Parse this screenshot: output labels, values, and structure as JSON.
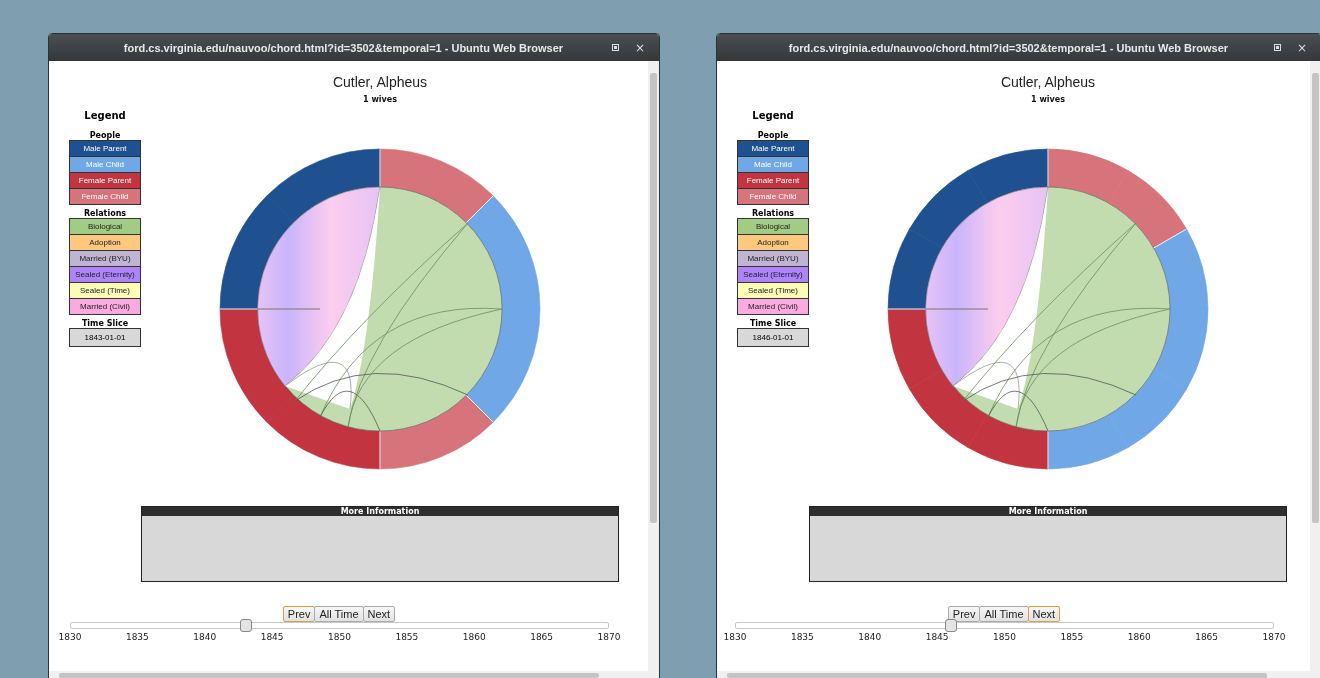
{
  "windows": [
    {
      "title": "ford.cs.virginia.edu/nauvoo/chord.html?id=3502&temporal=1 - Ubuntu Web Browser",
      "close": "×",
      "heading": "Cutler, Alpheus",
      "subheading": "1 wives",
      "legend": {
        "title": "Legend",
        "people_title": "People",
        "people": [
          {
            "label": "Male Parent",
            "color": "#1f5190"
          },
          {
            "label": "Male Child",
            "color": "#70a7e6"
          },
          {
            "label": "Female Parent",
            "color": "#c13440"
          },
          {
            "label": "Female Child",
            "color": "#d6737b"
          }
        ],
        "relations_title": "Relations",
        "relations": [
          {
            "label": "Biological",
            "color": "#a2cc85"
          },
          {
            "label": "Adoption",
            "color": "#fec97f"
          },
          {
            "label": "Married (BYU)",
            "color": "#bfb5d3"
          },
          {
            "label": "Sealed (Eternity)",
            "color": "#ad84fc"
          },
          {
            "label": "Sealed (Time)",
            "color": "#fbfdb6"
          },
          {
            "label": "Married (Civil)",
            "color": "#fbaae0"
          }
        ],
        "time_slice_title": "Time Slice",
        "time_slice": "1843-01-01"
      },
      "segments": [
        {
          "color": "#d6737b"
        },
        {
          "color": "#70a7e6"
        },
        {
          "color": "#70a7e6"
        },
        {
          "color": "#d6737b"
        },
        {
          "color": "#c13440"
        },
        {
          "color": "#c13440"
        },
        {
          "color": "#1f5190"
        },
        {
          "color": "#1f5190"
        }
      ],
      "more_info_title": "More Information",
      "buttons": [
        {
          "label": "Prev",
          "focused": true
        },
        {
          "label": "All Time",
          "focused": false
        },
        {
          "label": "Next",
          "focused": false
        }
      ],
      "slider": {
        "level": 0.325,
        "ticks": [
          "1830",
          "1835",
          "1840",
          "1845",
          "1850",
          "1855",
          "1860",
          "1865",
          "1870"
        ]
      }
    },
    {
      "title": "ford.cs.virginia.edu/nauvoo/chord.html?id=3502&temporal=1 - Ubuntu Web Browser",
      "close": "×",
      "heading": "Cutler, Alpheus",
      "subheading": "1 wives",
      "legend": {
        "title": "Legend",
        "people_title": "People",
        "people": [
          {
            "label": "Male Parent",
            "color": "#1f5190"
          },
          {
            "label": "Male Child",
            "color": "#70a7e6"
          },
          {
            "label": "Female Parent",
            "color": "#c13440"
          },
          {
            "label": "Female Child",
            "color": "#d6737b"
          }
        ],
        "relations_title": "Relations",
        "relations": [
          {
            "label": "Biological",
            "color": "#a2cc85"
          },
          {
            "label": "Adoption",
            "color": "#fec97f"
          },
          {
            "label": "Married (BYU)",
            "color": "#bfb5d3"
          },
          {
            "label": "Sealed (Eternity)",
            "color": "#ad84fc"
          },
          {
            "label": "Sealed (Time)",
            "color": "#fbfdb6"
          },
          {
            "label": "Married (Civil)",
            "color": "#fbaae0"
          }
        ],
        "time_slice_title": "Time Slice",
        "time_slice": "1846-01-01"
      },
      "segments": [
        {
          "color": "#d6737b"
        },
        {
          "color": "#d6737b"
        },
        {
          "color": "#70a7e6"
        },
        {
          "color": "#70a7e6"
        },
        {
          "color": "#70a7e6"
        },
        {
          "color": "#70a7e6"
        },
        {
          "color": "#c13440"
        },
        {
          "color": "#c13440"
        },
        {
          "color": "#c13440"
        },
        {
          "color": "#1f5190"
        },
        {
          "color": "#1f5190"
        },
        {
          "color": "#1f5190"
        }
      ],
      "more_info_title": "More Information",
      "buttons": [
        {
          "label": "Prev",
          "focused": false
        },
        {
          "label": "All Time",
          "focused": false
        },
        {
          "label": "Next",
          "focused": true
        }
      ],
      "slider": {
        "level": 0.4,
        "ticks": [
          "1830",
          "1835",
          "1840",
          "1845",
          "1850",
          "1855",
          "1860",
          "1865",
          "1870"
        ]
      }
    }
  ]
}
